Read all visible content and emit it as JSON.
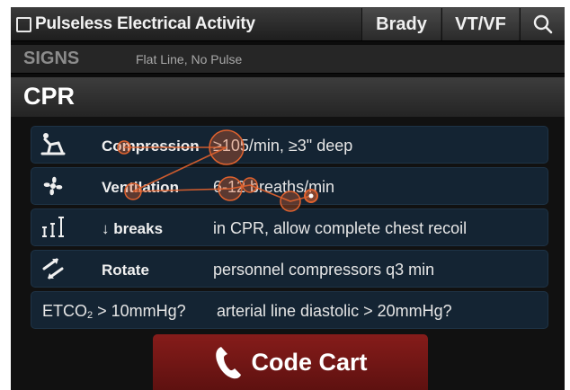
{
  "header": {
    "title": "Pulseless Electrical Activity",
    "tabs": [
      {
        "label": "Brady"
      },
      {
        "label": "VT/VF"
      }
    ]
  },
  "signs": {
    "heading": "SIGNS",
    "text": "Flat Line, No Pulse"
  },
  "cpr": {
    "heading": "CPR",
    "rows": [
      {
        "label": "Compression",
        "value": "≥105/min, ≥3\" deep",
        "icon": "compression-icon"
      },
      {
        "label": "Ventilation",
        "value": "6-12 breaths/min",
        "icon": "fan-icon"
      },
      {
        "label": "↓ breaks",
        "value": "in CPR, allow complete chest recoil",
        "icon": "recoil-icon"
      },
      {
        "label": "Rotate",
        "value": "personnel compressors q3 min",
        "icon": "rotate-arrows-icon"
      }
    ],
    "etco": {
      "label_prefix": "ETCO",
      "label_sub": "2",
      "label_suffix": " > 10mmHg?",
      "value": "arterial line diastolic > 20mmHg?"
    }
  },
  "code_cart": {
    "label": "Code Cart",
    "icon": "phone-icon"
  },
  "colors": {
    "accent_red": "#861c1a",
    "row_bg": "#142433",
    "gaze_marker": "#e0622e"
  }
}
